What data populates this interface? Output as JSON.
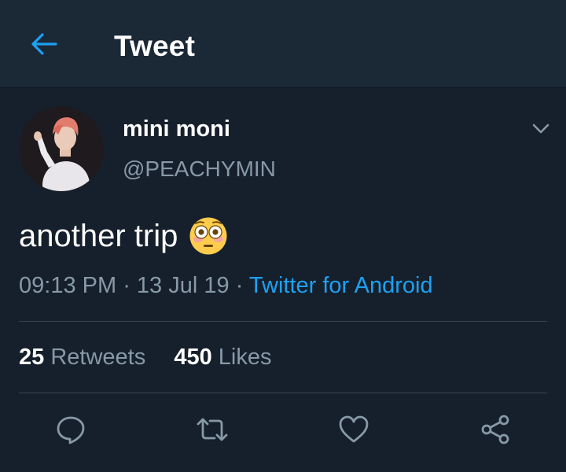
{
  "header": {
    "title": "Tweet",
    "back_icon": "arrow-left-icon"
  },
  "colors": {
    "background": "#16202c",
    "header_background": "#1b2836",
    "accent": "#1da1f2",
    "secondary_text": "#8899a6",
    "divider": "#38444d"
  },
  "tweet": {
    "display_name": "mini moni",
    "handle": "@PEACHYMIN",
    "text": "another trip",
    "emoji": "flushed-face-emoji",
    "time": "09:13 PM",
    "date": "13 Jul 19",
    "source": "Twitter for Android"
  },
  "stats": {
    "retweets_count": "25",
    "retweets_label": "Retweets",
    "likes_count": "450",
    "likes_label": "Likes"
  },
  "actions": [
    {
      "name": "reply",
      "icon": "reply-icon"
    },
    {
      "name": "retweet",
      "icon": "retweet-icon"
    },
    {
      "name": "like",
      "icon": "heart-icon"
    },
    {
      "name": "share",
      "icon": "share-icon"
    }
  ]
}
